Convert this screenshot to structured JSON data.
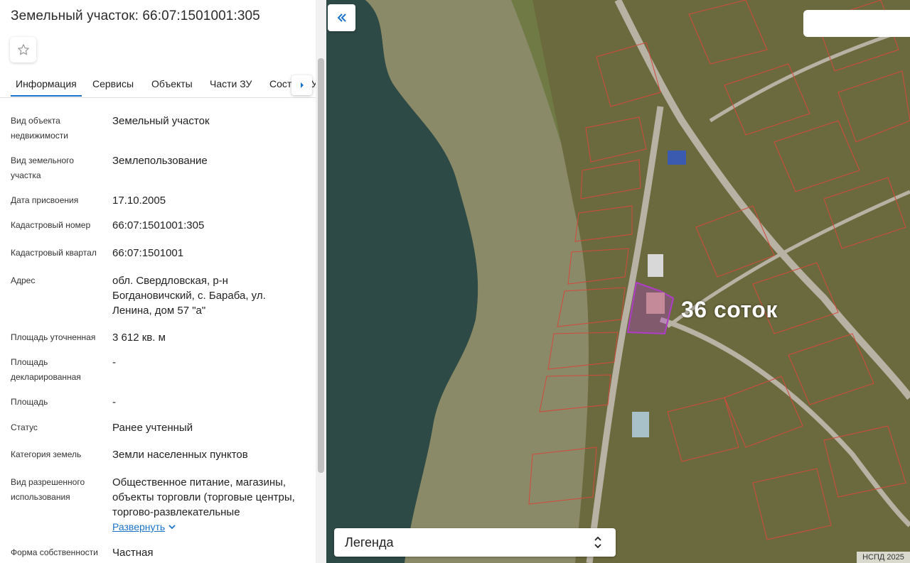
{
  "panel": {
    "title": "Земельный участок: 66:07:1501001:305",
    "favorite_icon": "star-outline-icon",
    "tabs": [
      "Информация",
      "Сервисы",
      "Объекты",
      "Части ЗУ",
      "Состав ЗУ"
    ],
    "active_tab": "Информация",
    "rows": [
      {
        "label": "Вид объекта недвижимости",
        "value": "Земельный участок"
      },
      {
        "label": "Вид земельного участка",
        "value": "Землепользование"
      },
      {
        "label": "Дата присвоения",
        "value": "17.10.2005"
      },
      {
        "label": "Кадастровый номер",
        "value": "66:07:1501001:305"
      },
      {
        "label": "Кадастровый квартал",
        "value": "66:07:1501001"
      },
      {
        "label": "Адрес",
        "value": "обл. Свердловская, р-н Богдановичский, с. Бараба, ул. Ленина, дом 57 \"а\""
      },
      {
        "label": "Площадь уточненная",
        "value": "3 612 кв. м"
      },
      {
        "label": "Площадь декларированная",
        "value": "-"
      },
      {
        "label": "Площадь",
        "value": "-"
      },
      {
        "label": "Статус",
        "value": "Ранее учтенный"
      },
      {
        "label": "Категория земель",
        "value": "Земли населенных пунктов"
      },
      {
        "label": "Вид разрешенного использования",
        "value": "Общественное питание, магазины, объекты торговли (торговые центры, торгово-развлекательные"
      },
      {
        "label": "Форма собственности",
        "value": "Частная"
      }
    ],
    "expand_label": "Развернуть"
  },
  "map": {
    "collapse_icon": "double-chevron-left-icon",
    "overlay_label": "36 соток",
    "legend_label": "Легенда",
    "copyright": "НСПД 2025",
    "colors": {
      "water": "#2e4a46",
      "shore": "#8a8a68",
      "land": "#6f7a45",
      "parcel_line": "#d24a3c",
      "highlight": "#b03cc8",
      "road": "#b8b2a4"
    }
  }
}
